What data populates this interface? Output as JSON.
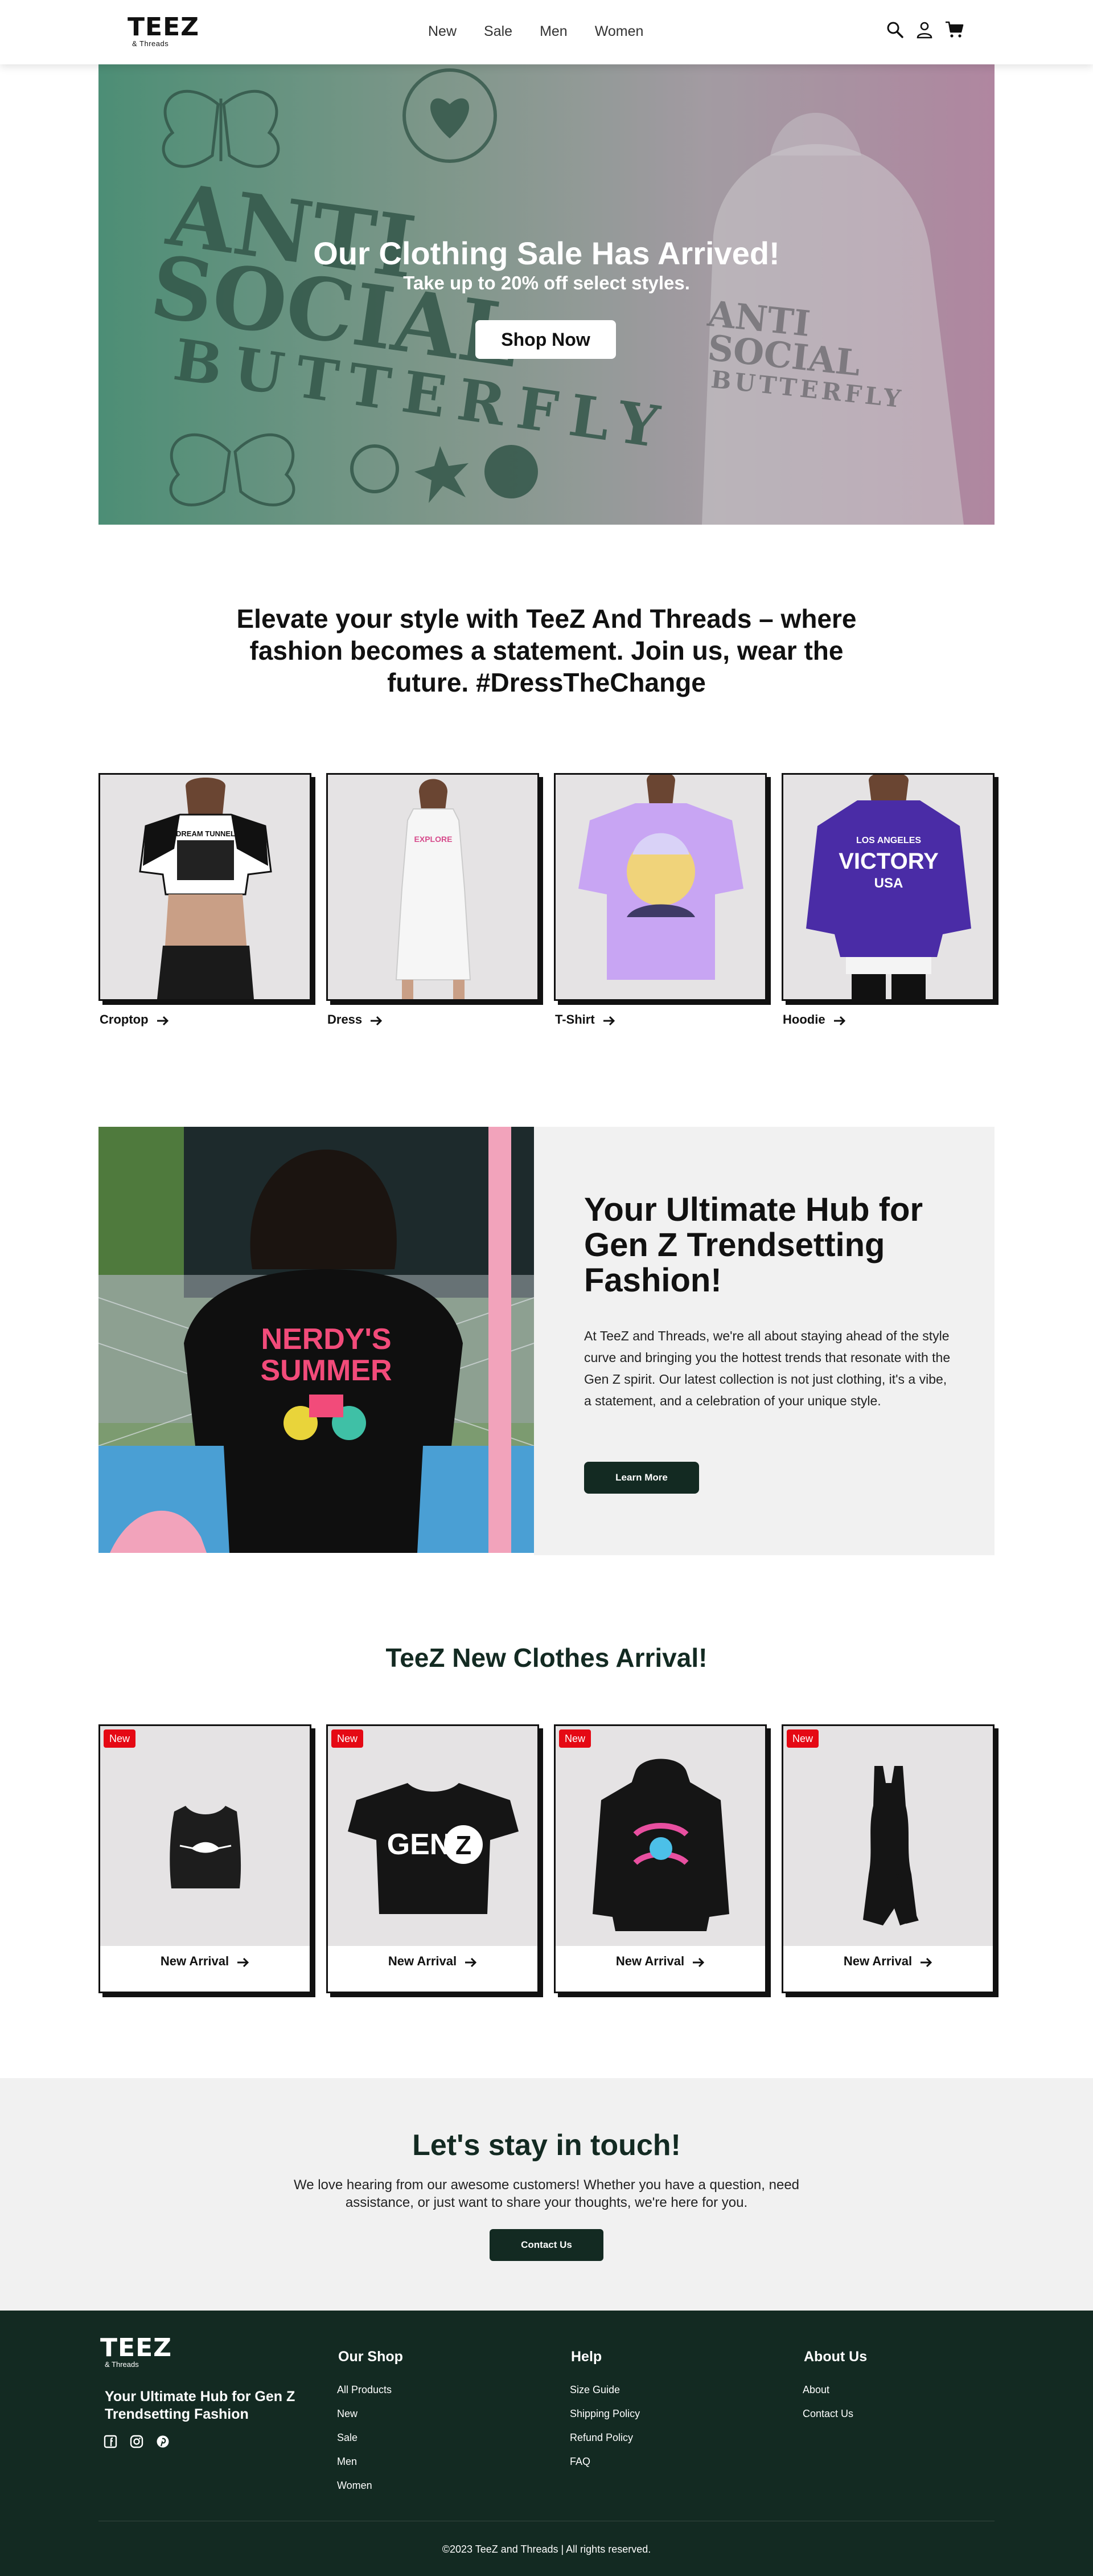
{
  "header": {
    "logo_main": "TEEZ",
    "logo_sub": "& Threads",
    "nav": [
      "New",
      "Sale",
      "Men",
      "Women"
    ],
    "icons": [
      "search-icon",
      "user-icon",
      "cart-icon"
    ]
  },
  "hero": {
    "title": "Our Clothing Sale Has Arrived!",
    "subtitle": "Take up to 20% off select styles.",
    "button": "Shop Now",
    "art_text": [
      "ANTI",
      "SOCIAL",
      "BUTTERFLY"
    ]
  },
  "tagline": "Elevate your style with TeeZ And Threads – where fashion becomes a statement. Join us, wear the future. #DressTheChange",
  "categories": [
    {
      "label": "Croptop"
    },
    {
      "label": "Dress"
    },
    {
      "label": "T-Shirt"
    },
    {
      "label": "Hoodie"
    }
  ],
  "category_art": {
    "croptop": "DREAM TUNNEL",
    "dress": "EXPLORE",
    "hoodie_top": "LOS ANGELES",
    "hoodie_mid": "VICTORY",
    "hoodie_bot": "USA"
  },
  "about": {
    "title": "Your Ultimate Hub for Gen Z Trendsetting Fashion!",
    "text": "At TeeZ and Threads, we're all about staying ahead of the style curve and bringing you the hottest trends that resonate with the Gen Z spirit. Our latest collection is not just clothing, it's a vibe, a statement, and a celebration of your unique style.",
    "button": "Learn More",
    "shirt_line1": "NERDY'S",
    "shirt_line2": "SUMMER"
  },
  "arrivals": {
    "title": "TeeZ New Clothes Arrival!",
    "items": [
      {
        "badge": "New",
        "link": "New Arrival"
      },
      {
        "badge": "New",
        "link": "New Arrival"
      },
      {
        "badge": "New",
        "link": "New Arrival"
      },
      {
        "badge": "New",
        "link": "New Arrival"
      }
    ],
    "tee_text": "GEN",
    "tee_letter": "Z"
  },
  "contact": {
    "title": "Let's stay in touch!",
    "text": "We love hearing from our awesome customers! Whether you have a question, need assistance, or just want to share your thoughts, we're here for you.",
    "button": "Contact Us"
  },
  "footer": {
    "logo_main": "TEEZ",
    "logo_sub": "& Threads",
    "tagline": "Your Ultimate Hub for Gen Z Trendsetting Fashion",
    "social_icons": [
      "facebook-icon",
      "instagram-icon",
      "pinterest-icon"
    ],
    "columns": [
      {
        "title": "Our Shop",
        "items": [
          "All Products",
          "New",
          "Sale",
          "Men",
          "Women"
        ]
      },
      {
        "title": "Help",
        "items": [
          "Size Guide",
          "Shipping Policy",
          "Refund Policy",
          "FAQ"
        ]
      },
      {
        "title": "About Us",
        "items": [
          "About",
          "Contact Us"
        ]
      }
    ],
    "copyright": "©2023 TeeZ and Threads | All rights reserved."
  },
  "colors": {
    "brand_dark": "#132a22",
    "badge_red": "#e50914",
    "panel_gray": "#f1f1f1",
    "card_gray": "#e5e3e4"
  }
}
